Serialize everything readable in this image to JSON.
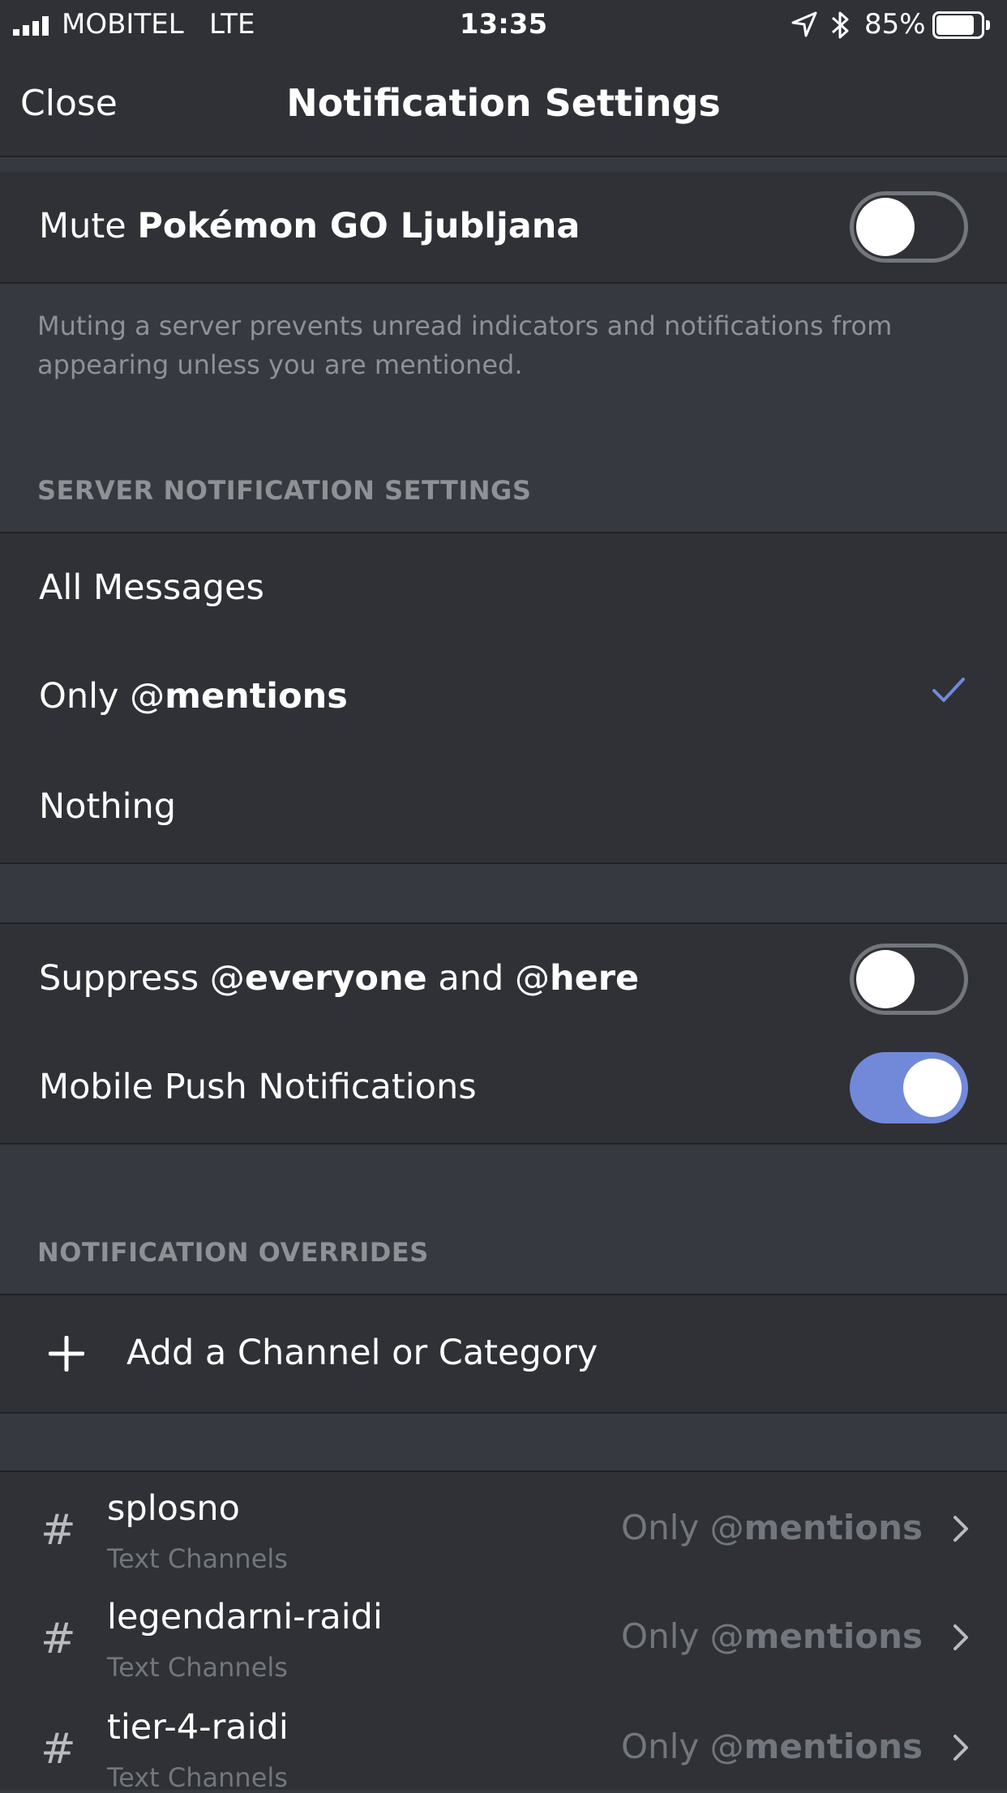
{
  "status_bar": {
    "carrier": "MOBITEL",
    "network": "LTE",
    "time": "13:35",
    "battery": "85%",
    "battery_level": 0.85
  },
  "header": {
    "close_label": "Close",
    "title": "Notification Settings"
  },
  "mute": {
    "prefix": "Mute ",
    "server_name": "Pokémon GO Ljubljana",
    "enabled": false,
    "hint": "Muting a server prevents unread indicators and notifications from appearing unless you are mentioned."
  },
  "server_notifications": {
    "header": "SERVER NOTIFICATION SETTINGS",
    "options": [
      {
        "label": "All Messages"
      },
      {
        "prefix": "Only @",
        "bold": "mentions",
        "selected": true
      },
      {
        "label": "Nothing"
      }
    ]
  },
  "suppress": {
    "t1": "Suppress @",
    "b1": "everyone",
    "t2": " and @",
    "b2": "here",
    "enabled": false
  },
  "push": {
    "label": "Mobile Push Notifications",
    "enabled": true
  },
  "overrides": {
    "header": "NOTIFICATION OVERRIDES",
    "add_label": "Add a Channel or Category",
    "channels": [
      {
        "name": "splosno",
        "category": "Text Channels",
        "value_prefix": "Only @",
        "value_bold": "mentions"
      },
      {
        "name": "legendarni-raidi",
        "category": "Text Channels",
        "value_prefix": "Only @",
        "value_bold": "mentions"
      },
      {
        "name": "tier-4-raidi",
        "category": "Text Channels",
        "value_prefix": "Only @",
        "value_bold": "mentions"
      }
    ]
  },
  "colors": {
    "background": "#36393f",
    "row": "#2f3136",
    "accent": "#7289da",
    "muted_text": "#8e9297"
  }
}
